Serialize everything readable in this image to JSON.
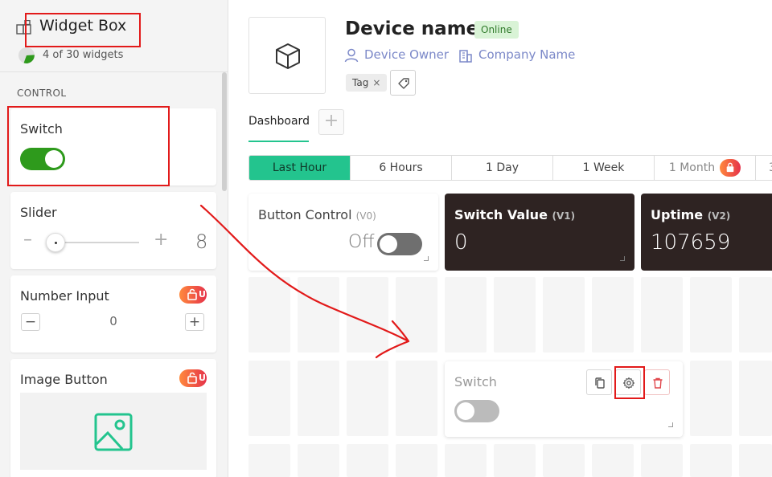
{
  "sidebar": {
    "title": "Widget Box",
    "count": "4 of 30 widgets",
    "section": "CONTROL",
    "widgets": {
      "switch": {
        "title": "Switch"
      },
      "slider": {
        "title": "Slider",
        "value": "8"
      },
      "number_input": {
        "title": "Number Input",
        "value": "0",
        "lock_suffix": "U"
      },
      "image_button": {
        "title": "Image Button",
        "lock_suffix": "U"
      }
    }
  },
  "device": {
    "name": "Device name",
    "status": "Online",
    "owner": "Device Owner",
    "company": "Company Name",
    "tag": "Tag",
    "tag_remove": "×"
  },
  "tabs": {
    "dashboard": "Dashboard",
    "add": "+"
  },
  "time_range": {
    "options": [
      "Last Hour",
      "6 Hours",
      "1 Day",
      "1 Week",
      "1 Month",
      "3"
    ],
    "selected": "Last Hour"
  },
  "dashboard": {
    "button_control": {
      "title": "Button Control",
      "pin": "(V0)",
      "state": "Off"
    },
    "switch_value": {
      "title": "Switch Value",
      "pin": "(V1)",
      "value": "0"
    },
    "uptime": {
      "title": "Uptime",
      "pin": "(V2)",
      "value": "107659"
    },
    "switch_widget": {
      "title": "Switch"
    }
  },
  "colors": {
    "accent": "#23c48e",
    "switch_on": "#2e9a1c",
    "dark_card": "#2e2322",
    "link": "#7b88c8",
    "online_bg": "#d9f3d6",
    "annotation": "#e21a1a"
  }
}
